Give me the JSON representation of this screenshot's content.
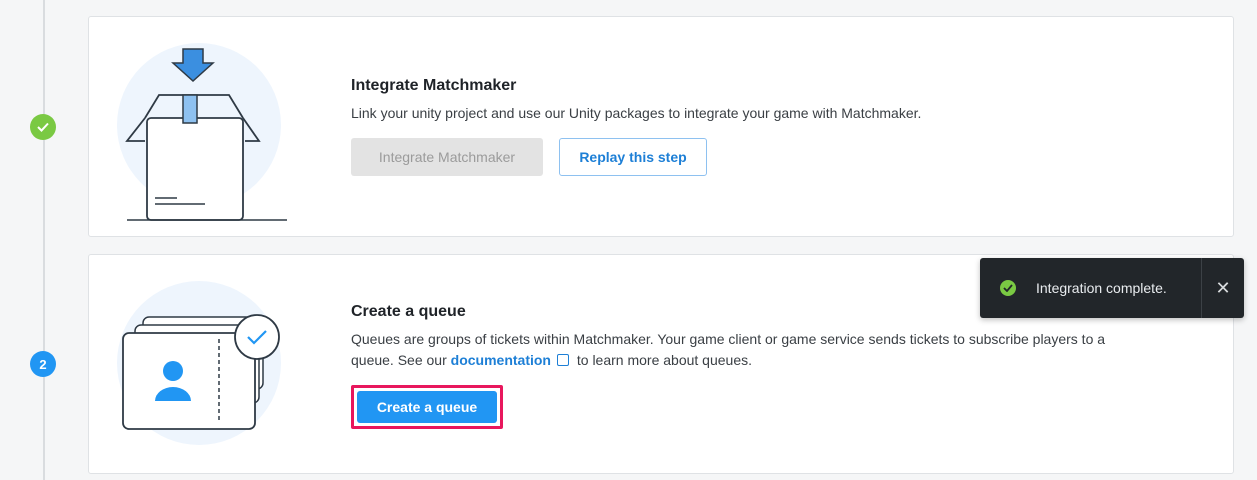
{
  "steps": [
    {
      "status": "done",
      "marker": "✓",
      "title": "Integrate Matchmaker",
      "description": "Link your unity project and use our Unity packages to integrate your game with Matchmaker.",
      "primary_button": "Integrate Matchmaker",
      "secondary_button": "Replay this step",
      "icon": "package-download-illustration"
    },
    {
      "status": "active",
      "marker": "2",
      "title": "Create a queue",
      "description_part1": "Queues are groups of tickets within Matchmaker. Your game client or game service sends tickets to subscribe players to a queue. See our ",
      "link_text": "documentation",
      "description_part2": " to learn more about queues.",
      "primary_button": "Create a queue",
      "icon": "ticket-queue-illustration"
    }
  ],
  "toast": {
    "message": "Integration complete.",
    "close_symbol": "✕",
    "icon": "success-check-icon"
  },
  "colors": {
    "success": "#7ac943",
    "accent": "#2196f3",
    "highlight": "#e8175d"
  }
}
